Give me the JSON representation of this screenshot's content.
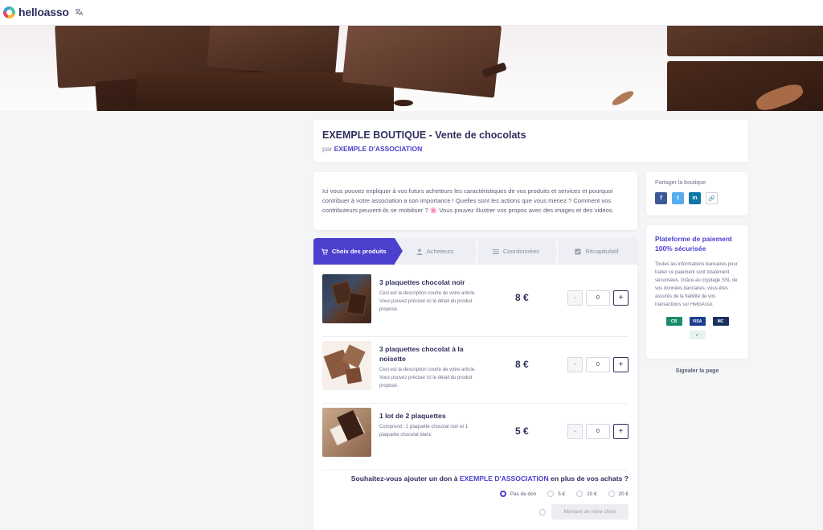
{
  "header": {
    "logo_text": "helloasso",
    "language_icon": "translate-icon"
  },
  "campaign": {
    "title": "EXEMPLE BOUTIQUE - Vente de chocolats",
    "by_prefix": "par",
    "organization": "EXEMPLE D'ASSOCIATION"
  },
  "description": "Ici vous pouvez expliquer à vos futurs acheteurs les caractéristiques de vos produits et services et pourquoi contribuer à votre association a son importance ! Quelles sont les actions que vous menez ? Comment vos contributeurs peuvent-ils se mobiliser ? 🌸 Vous pouvez illustrer vos propos avec des images et des vidéos.",
  "steps": [
    {
      "label": "Choix des produits",
      "icon": "cart-icon",
      "active": true
    },
    {
      "label": "Acheteurs",
      "icon": "user-icon",
      "active": false
    },
    {
      "label": "Coordonnées",
      "icon": "list-icon",
      "active": false
    },
    {
      "label": "Récapitulatif",
      "icon": "checklist-icon",
      "active": false
    }
  ],
  "products": [
    {
      "name": "3 plaquettes chocolat noir",
      "description": "Ceci est la description courte de votre article. Vous pouvez préciser ici le détail du produit proposé.",
      "price": "8 €",
      "quantity": "0"
    },
    {
      "name": "3 plaquettes chocolat à la noisette",
      "description": "Ceci est la description courte de votre article. Vous pouvez préciser ici le détail du produit proposé.",
      "price": "8 €",
      "quantity": "0"
    },
    {
      "name": "1 lot de 2 plaquettes",
      "description": "Comprend : 1 plaquette chocolat noir et 1 plaquette chocolat blanc",
      "price": "5 €",
      "quantity": "0"
    }
  ],
  "quantity_controls": {
    "minus": "-",
    "plus": "+"
  },
  "donation": {
    "question_prefix": "Souhaitez-vous ajouter un don à",
    "question_org": "EXEMPLE D'ASSOCIATION",
    "question_suffix": "en plus de vos achats ?",
    "options": [
      "Pas de don",
      "5 €",
      "10 €",
      "20 €"
    ],
    "selected": "Pas de don",
    "custom_placeholder": "Montant de votre choix"
  },
  "share": {
    "title": "Partager la boutique",
    "buttons": [
      {
        "name": "facebook-icon",
        "glyph": "f"
      },
      {
        "name": "twitter-icon",
        "glyph": "t"
      },
      {
        "name": "linkedin-icon",
        "glyph": "in"
      },
      {
        "name": "link-icon",
        "glyph": "🔗"
      }
    ]
  },
  "security": {
    "title": "Plateforme de paiement 100% sécurisée",
    "text": "Toutes les informations bancaires pour traiter ce paiement sont totalement sécurisées. Grâce au cryptage SSL de vos données bancaires, vous êtes assurés de la fiabilité de vos transactions sur HelloAsso.",
    "cards": [
      "CB",
      "VISA",
      "MC"
    ]
  },
  "report_link": "Signaler la page",
  "colors": {
    "accent": "#4c40cf",
    "text": "#2e2f5e",
    "background": "#f4f5f7"
  }
}
